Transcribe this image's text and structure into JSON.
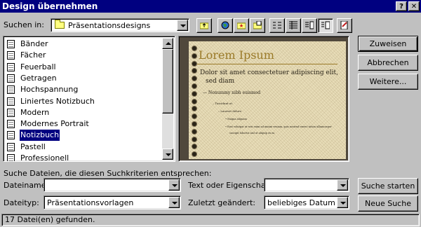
{
  "window": {
    "title": "Design übernehmen",
    "help_label": "?",
    "close_label": "✕"
  },
  "look_in": {
    "label": "Suchen in:",
    "value": "Präsentationsdesigns"
  },
  "toolbar": {
    "icons": [
      "up-one-level-icon",
      "search-web-icon",
      "favorites-icon",
      "add-to-favorites-icon",
      "list-view-icon",
      "details-view-icon",
      "properties-view-icon",
      "preview-view-icon",
      "commands-icon"
    ]
  },
  "designs": [
    "Bänder",
    "Fächer",
    "Feuerball",
    "Getragen",
    "Hochspannung",
    "Liniertes Notizbuch",
    "Modern",
    "Modernes Portrait",
    "Notizbuch",
    "Pastell",
    "Professionell"
  ],
  "selected_index": 8,
  "preview": {
    "title": "Lorem Ipsum",
    "bullet1": "Dolor sit amet consectetuer adipiscing elit,",
    "bullet1b": "sed diam",
    "bullet2": "— Nonummy nibh euismod",
    "bullet3": "– Tincidunt ut",
    "bullet4": "– Laoreet dolore",
    "bullet5": "• Magna aliquam",
    "bullet6": "• Erat volutpat ut wisi enim ad minim veniam, quis nostrud exerci tation ullamcorper",
    "bullet6b": "suscipit lobortis nisl ut aliquip ex ea"
  },
  "buttons": {
    "apply": "Zuweisen",
    "cancel": "Abbrechen",
    "more": "Weitere...",
    "find_now": "Suche starten",
    "new_search": "Neue Suche"
  },
  "search": {
    "heading": "Suche Dateien, die diesen Suchkriterien entsprechen:",
    "filename_label": "Dateiname:",
    "filename_value": "",
    "filetype_label": "Dateityp:",
    "filetype_value": "Präsentationsvorlagen",
    "text_label": "Text oder Eigenschaft:",
    "text_value": "",
    "modified_label": "Zuletzt geändert:",
    "modified_value": "beliebiges Datum"
  },
  "status": "17 Datei(en) gefunden.",
  "colors": {
    "titlebar": "#000080",
    "face": "#c0c0c0",
    "selection": "#000080",
    "preview_accent": "#9a7a28"
  }
}
